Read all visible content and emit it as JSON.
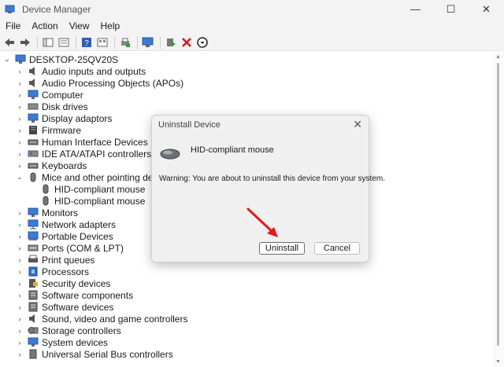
{
  "window": {
    "title": "Device Manager",
    "controls": {
      "minimize": "—",
      "maximize": "☐",
      "close": "✕"
    }
  },
  "menu": [
    "File",
    "Action",
    "View",
    "Help"
  ],
  "tree": {
    "root": "DESKTOP-25QV20S",
    "categories": [
      "Audio inputs and outputs",
      "Audio Processing Objects (APOs)",
      "Computer",
      "Disk drives",
      "Display adaptors",
      "Firmware",
      "Human Interface Devices",
      "IDE ATA/ATAPI controllers",
      "Keyboards",
      "Mice and other pointing devices",
      "HID-compliant mouse",
      "HID-compliant mouse",
      "Monitors",
      "Network adapters",
      "Portable Devices",
      "Ports (COM & LPT)",
      "Print queues",
      "Processors",
      "Security devices",
      "Software components",
      "Software devices",
      "Sound, video and game controllers",
      "Storage controllers",
      "System devices",
      "Universal Serial Bus controllers"
    ]
  },
  "dialog": {
    "title": "Uninstall Device",
    "device_name": "HID-compliant mouse",
    "warning": "Warning: You are about to uninstall this device from your system.",
    "uninstall_label": "Uninstall",
    "cancel_label": "Cancel",
    "close_glyph": "✕"
  },
  "colors": {
    "annotation_arrow": "#e11b1b",
    "toolbar_red_x": "#d11b1b",
    "window_chrome": "#f3f3f3"
  }
}
